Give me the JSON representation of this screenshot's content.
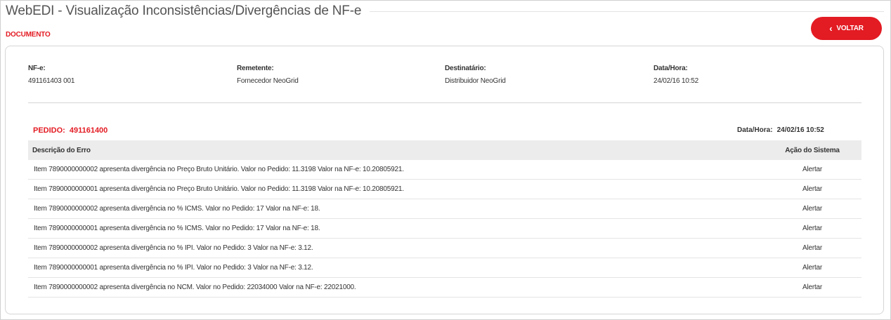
{
  "app_title": "WebEDI - Visualização Inconsistências/Divergências de NF-e",
  "section_label": "DOCUMENTO",
  "back_button": {
    "label": "VOLTAR",
    "icon": "chevron-left-icon"
  },
  "document": {
    "nfe": {
      "label": "NF-e:",
      "value": "491161403 001"
    },
    "sender": {
      "label": "Remetente:",
      "value": "Fornecedor NeoGrid"
    },
    "recipient": {
      "label": "Destinatário:",
      "value": "Distribuidor NeoGrid"
    },
    "datetime": {
      "label": "Data/Hora:",
      "value": "24/02/16 10:52"
    }
  },
  "order": {
    "label": "PEDIDO:",
    "number": "491161400",
    "date_label": "Data/Hora:",
    "date_value": "24/02/16 10:52"
  },
  "table": {
    "headers": {
      "description": "Descrição do Erro",
      "action": "Ação do Sistema"
    },
    "rows": [
      {
        "description": "Item 7890000000002 apresenta divergência no Preço Bruto Unitário. Valor no Pedido: 11.3198 Valor na NF-e: 10.20805921.",
        "action": "Alertar"
      },
      {
        "description": "Item 7890000000001 apresenta divergência no Preço Bruto Unitário. Valor no Pedido: 11.3198 Valor na NF-e: 10.20805921.",
        "action": "Alertar"
      },
      {
        "description": "Item 7890000000002 apresenta divergência no % ICMS. Valor no Pedido: 17 Valor na NF-e: 18.",
        "action": "Alertar"
      },
      {
        "description": "Item 7890000000001 apresenta divergência no % ICMS. Valor no Pedido: 17 Valor na NF-e: 18.",
        "action": "Alertar"
      },
      {
        "description": "Item 7890000000002 apresenta divergência no % IPI. Valor no Pedido: 3 Valor na NF-e: 3.12.",
        "action": "Alertar"
      },
      {
        "description": "Item 7890000000001 apresenta divergência no % IPI. Valor no Pedido: 3 Valor na NF-e: 3.12.",
        "action": "Alertar"
      },
      {
        "description": "Item 7890000000002 apresenta divergência no NCM. Valor no Pedido: 22034000 Valor na NF-e: 22021000.",
        "action": "Alertar"
      }
    ]
  },
  "colors": {
    "accent": "#e31b23",
    "header_bg": "#ececec",
    "text": "#333333"
  }
}
